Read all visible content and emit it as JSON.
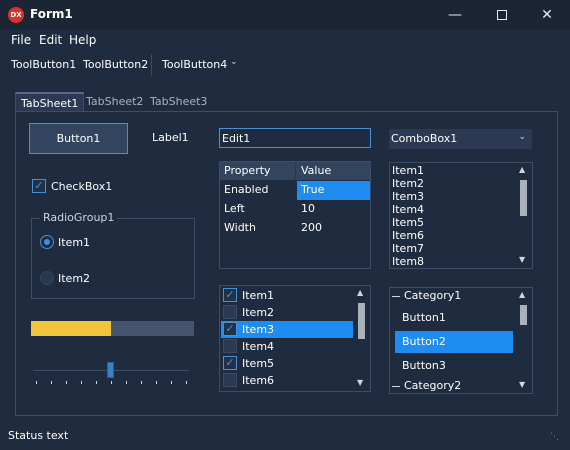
{
  "window": {
    "title": "Form1",
    "icon_text": "DX"
  },
  "menu": [
    "File",
    "Edit",
    "Help"
  ],
  "toolbar": {
    "b1": "ToolButton1",
    "b2": "ToolButton2",
    "b4": "ToolButton4"
  },
  "tabs": [
    "TabSheet1",
    "TabSheet2",
    "TabSheet3"
  ],
  "button1": "Button1",
  "label1": "Label1",
  "edit1": "Edit1",
  "combobox1": "ComboBox1",
  "checkbox1": {
    "label": "CheckBox1",
    "checked": true
  },
  "radiogroup": {
    "caption": "RadioGroup1",
    "items": [
      "Item1",
      "Item2"
    ],
    "selected": 0
  },
  "progress": {
    "value": 0.49
  },
  "trackbar": {
    "value": 0.5
  },
  "grid": {
    "headers": [
      "Property",
      "Value"
    ],
    "rows": [
      [
        "Enabled",
        "True"
      ],
      [
        "Left",
        "10"
      ],
      [
        "Width",
        "200"
      ]
    ]
  },
  "listbox": [
    "Item1",
    "Item2",
    "Item3",
    "Item4",
    "Item5",
    "Item6",
    "Item7",
    "Item8"
  ],
  "checklist": {
    "items": [
      "Item1",
      "Item2",
      "Item3",
      "Item4",
      "Item5",
      "Item6"
    ],
    "checked": [
      true,
      false,
      true,
      false,
      true,
      false
    ],
    "selected": 2
  },
  "category": {
    "cat1": "Category1",
    "buttons": [
      "Button1",
      "Button2",
      "Button3"
    ],
    "selected": 1,
    "cat2": "Category2"
  },
  "status": "Status text",
  "colors": {
    "accent": "#1e8cf0",
    "progress_fill": "#f0c53c",
    "bg": "#1f2b3e"
  }
}
